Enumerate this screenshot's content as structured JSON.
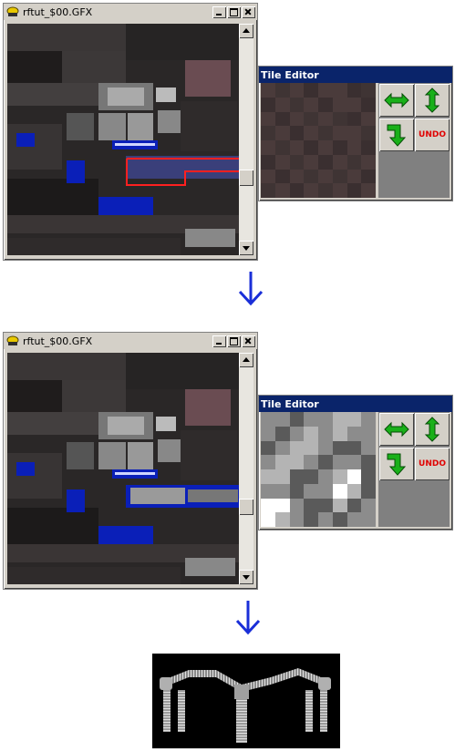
{
  "windows": [
    {
      "title": "rftut_$00.GFX"
    },
    {
      "title": "rftut_$00.GFX"
    }
  ],
  "tile_editor": {
    "title": "Tile Editor",
    "undo_label": "UNDO",
    "icons": [
      "horizontal-flip-icon",
      "vertical-flip-icon",
      "rotate-icon"
    ],
    "tiles_before": [
      "#4a3b3b",
      "#3f3434",
      "#4a3b3b",
      "#3a2f30",
      "#4a3b3b",
      "#4a3b3b",
      "#3a2f30",
      "#3f3434",
      "#3a2f30",
      "#4a3b3b",
      "#3f3434",
      "#4a3b3b",
      "#3a2f30",
      "#4a3b3b",
      "#4a3b3b",
      "#3a2f30",
      "#4a3b3b",
      "#3a2f30",
      "#4a3b3b",
      "#3f3434",
      "#4a3b3b",
      "#3f3434",
      "#3a2f30",
      "#4a3b3b",
      "#3f3434",
      "#4a3b3b",
      "#3a2f30",
      "#4a3b3b",
      "#3f3434",
      "#4a3b3b",
      "#4a3b3b",
      "#3f3434",
      "#4a3b3b",
      "#3f3434",
      "#4a3b3b",
      "#3a2f30",
      "#4a3b3b",
      "#3a2f30",
      "#4a3b3b",
      "#3a2f30",
      "#3a2f30",
      "#4a3b3b",
      "#3f3434",
      "#4a3b3b",
      "#3a2f30",
      "#4a3b3b",
      "#3f3434",
      "#4a3b3b",
      "#4a3b3b",
      "#3a2f30",
      "#4a3b3b",
      "#3f3434",
      "#4a3b3b",
      "#3f3434",
      "#4a3b3b",
      "#3a2f30",
      "#3f3434",
      "#4a3b3b",
      "#3a2f30",
      "#4a3b3b",
      "#3f3434",
      "#4a3b3b",
      "#3a2f30",
      "#4a3b3b"
    ],
    "tiles_after": [
      "#8c8c8c",
      "#8c8c8c",
      "#5a5a5a",
      "#8c8c8c",
      "#8c8c8c",
      "#b4b4b4",
      "#b4b4b4",
      "#8c8c8c",
      "#8c8c8c",
      "#5a5a5a",
      "#8c8c8c",
      "#b4b4b4",
      "#8c8c8c",
      "#b4b4b4",
      "#8c8c8c",
      "#8c8c8c",
      "#5a5a5a",
      "#8c8c8c",
      "#b4b4b4",
      "#b4b4b4",
      "#8c8c8c",
      "#5a5a5a",
      "#5a5a5a",
      "#8c8c8c",
      "#8c8c8c",
      "#b4b4b4",
      "#b4b4b4",
      "#8c8c8c",
      "#5a5a5a",
      "#8c8c8c",
      "#8c8c8c",
      "#5a5a5a",
      "#b4b4b4",
      "#b4b4b4",
      "#5a5a5a",
      "#5a5a5a",
      "#8c8c8c",
      "#b4b4b4",
      "#ffffff",
      "#5a5a5a",
      "#8c8c8c",
      "#8c8c8c",
      "#5a5a5a",
      "#8c8c8c",
      "#8c8c8c",
      "#ffffff",
      "#b4b4b4",
      "#5a5a5a",
      "#ffffff",
      "#ffffff",
      "#8c8c8c",
      "#5a5a5a",
      "#5a5a5a",
      "#b4b4b4",
      "#5a5a5a",
      "#8c8c8c",
      "#ffffff",
      "#b4b4b4",
      "#8c8c8c",
      "#5a5a5a",
      "#8c8c8c",
      "#5a5a5a",
      "#8c8c8c",
      "#8c8c8c"
    ]
  },
  "colors": {
    "selection": "#ff2020",
    "arrow": "#1a2fd8",
    "blue_tile": "#0a1fb8"
  }
}
